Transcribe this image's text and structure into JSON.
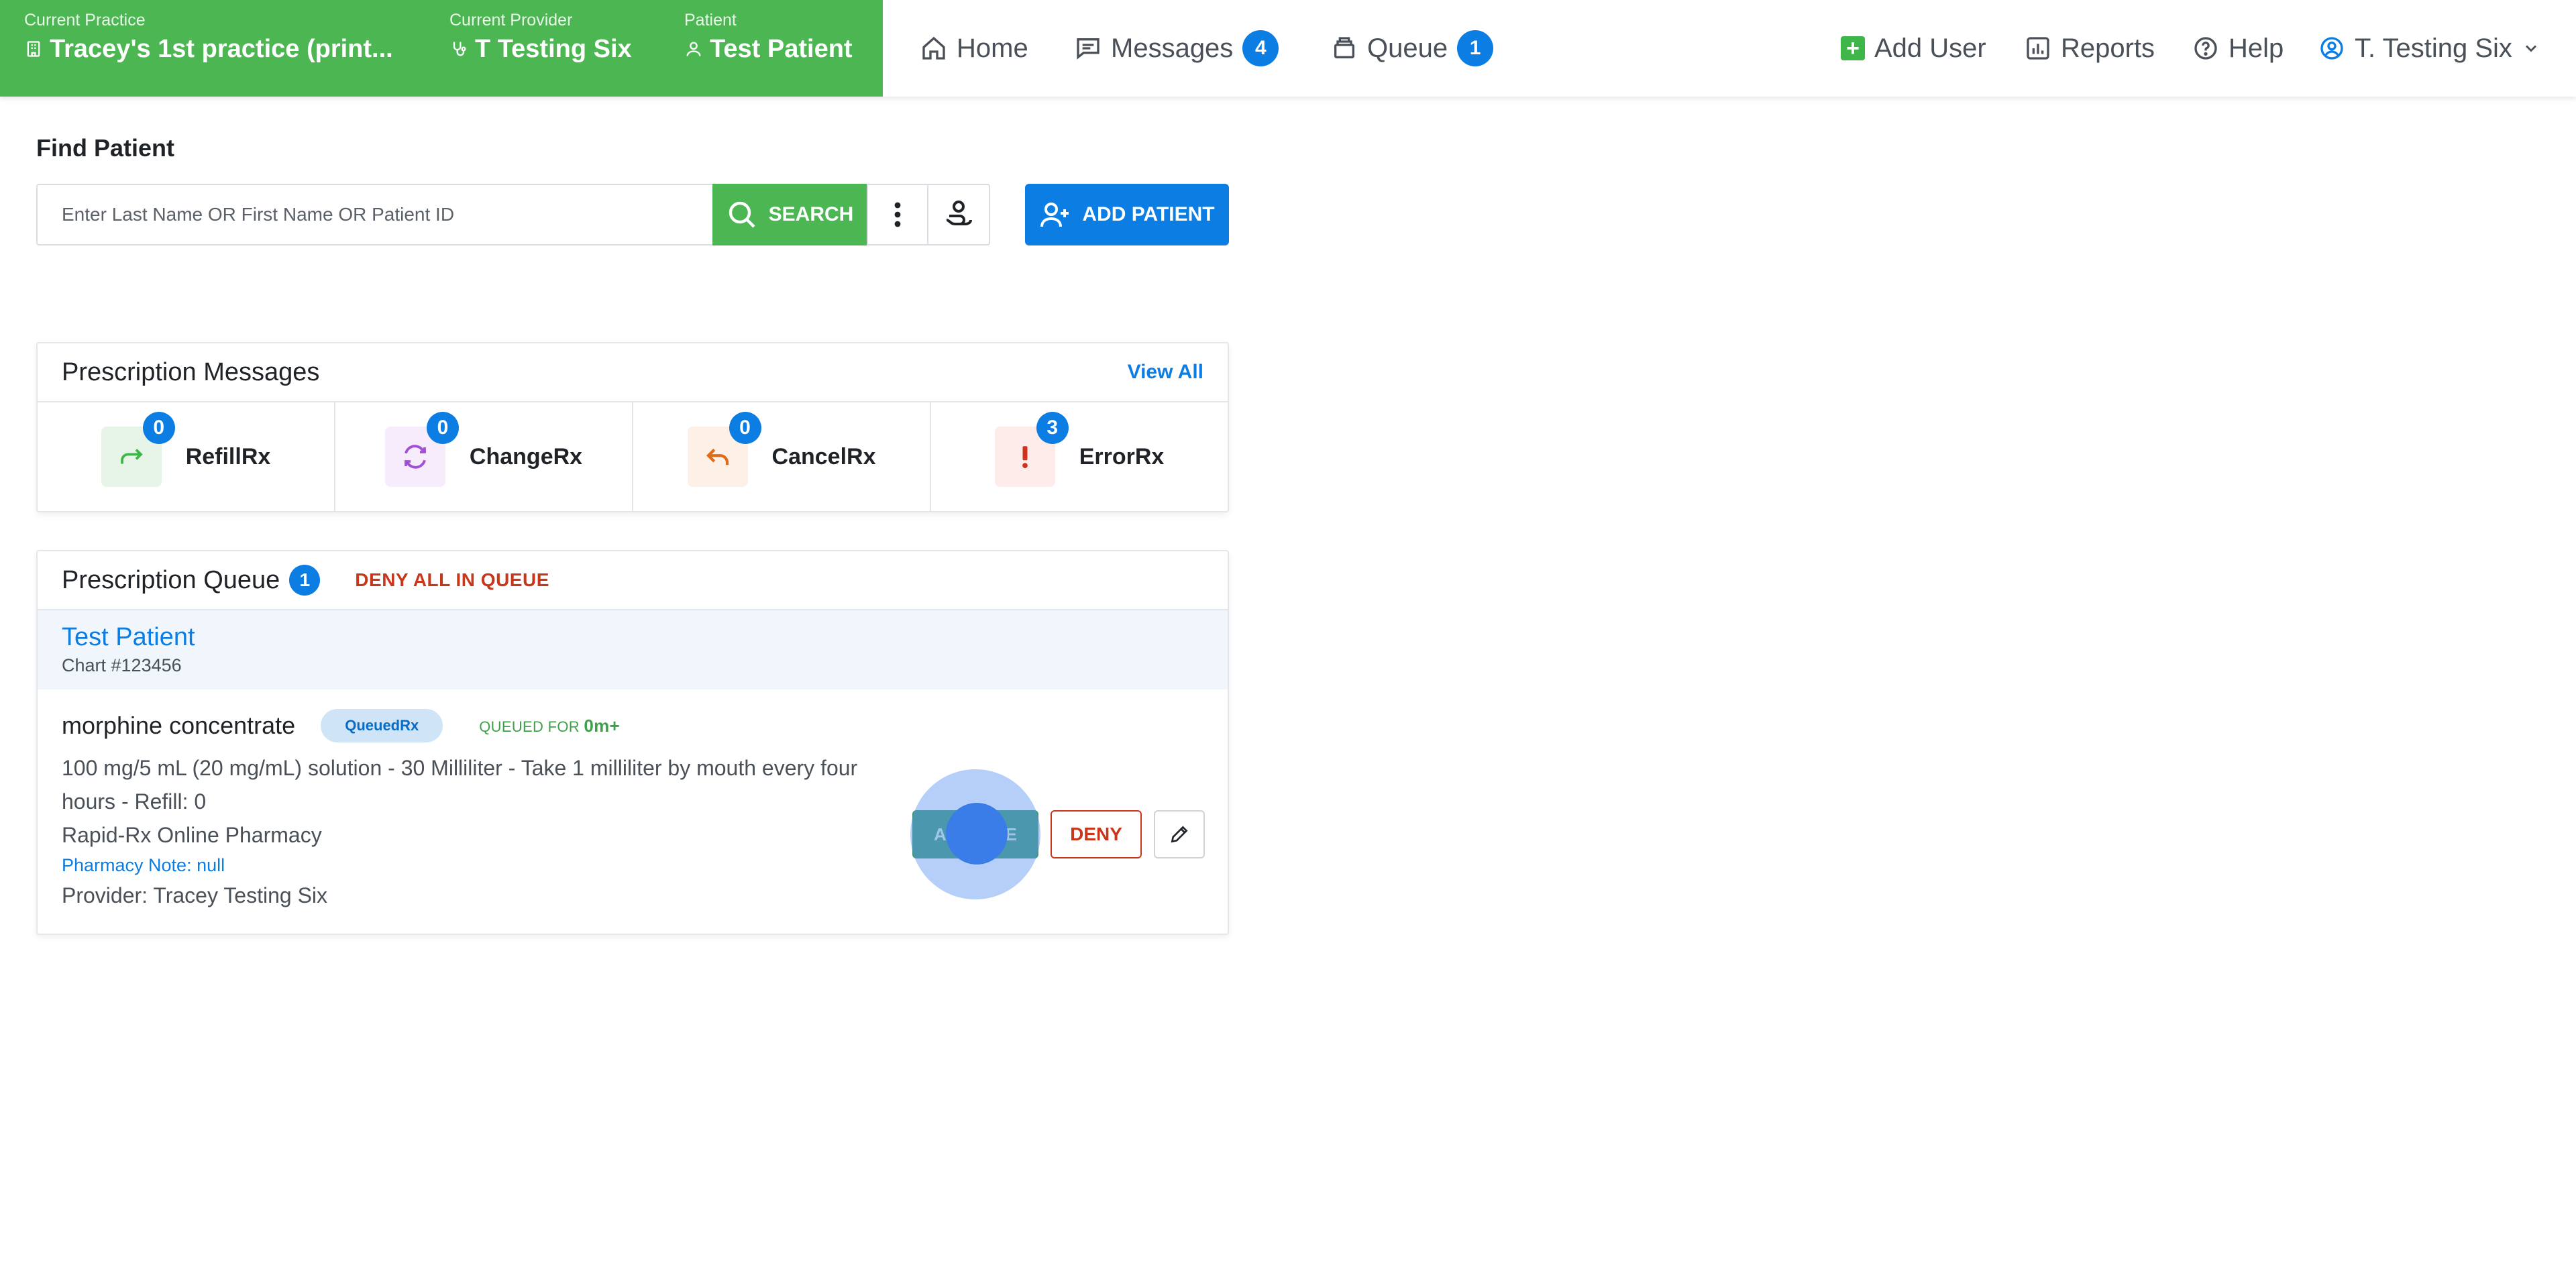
{
  "header": {
    "context": {
      "practice_label": "Current Practice",
      "practice_value": "Tracey's 1st practice (print...",
      "provider_label": "Current Provider",
      "provider_value": "T Testing Six",
      "patient_label": "Patient",
      "patient_value": "Test Patient"
    },
    "nav": {
      "home": "Home",
      "messages": "Messages",
      "messages_count": "4",
      "queue": "Queue",
      "queue_count": "1"
    },
    "right": {
      "add_user": "Add User",
      "reports": "Reports",
      "help": "Help",
      "user": "T. Testing Six"
    }
  },
  "find_patient": {
    "title": "Find Patient",
    "placeholder": "Enter Last Name OR First Name OR Patient ID",
    "search_label": "SEARCH",
    "add_patient_label": "ADD PATIENT"
  },
  "prescription_messages": {
    "title": "Prescription Messages",
    "view_all": "View All",
    "items": [
      {
        "label": "RefillRx",
        "count": "0",
        "icon": "refill-arrow-icon",
        "color": "#3fb64a"
      },
      {
        "label": "ChangeRx",
        "count": "0",
        "icon": "change-cycle-icon",
        "color": "#a04fd6"
      },
      {
        "label": "CancelRx",
        "count": "0",
        "icon": "undo-arrow-icon",
        "color": "#e06a1b"
      },
      {
        "label": "ErrorRx",
        "count": "3",
        "icon": "exclamation-icon",
        "color": "#d0311d"
      }
    ]
  },
  "prescription_queue": {
    "title": "Prescription Queue",
    "count": "1",
    "deny_all": "DENY ALL IN QUEUE",
    "patient_name": "Test Patient",
    "chart": "Chart #123456",
    "rx": {
      "drug": "morphine concentrate",
      "status_pill": "QueuedRx",
      "queued_for_label": "QUEUED FOR",
      "queued_for_value": "0m+",
      "detail": "100 mg/5 mL (20 mg/mL) solution - 30 Milliliter - Take 1 milliliter by mouth every four hours - Refill: 0",
      "pharmacy": "Rapid-Rx Online Pharmacy",
      "pharmacy_note": "Pharmacy Note: null",
      "provider": "Provider: Tracey Testing Six",
      "approve_left": "A",
      "approve_right": "E",
      "deny_label": "DENY"
    }
  },
  "colors": {
    "brand_green": "#4cb752",
    "primary_blue": "#0b7de3",
    "danger_red": "#c8361b",
    "approve_teal": "#3c9a78"
  }
}
